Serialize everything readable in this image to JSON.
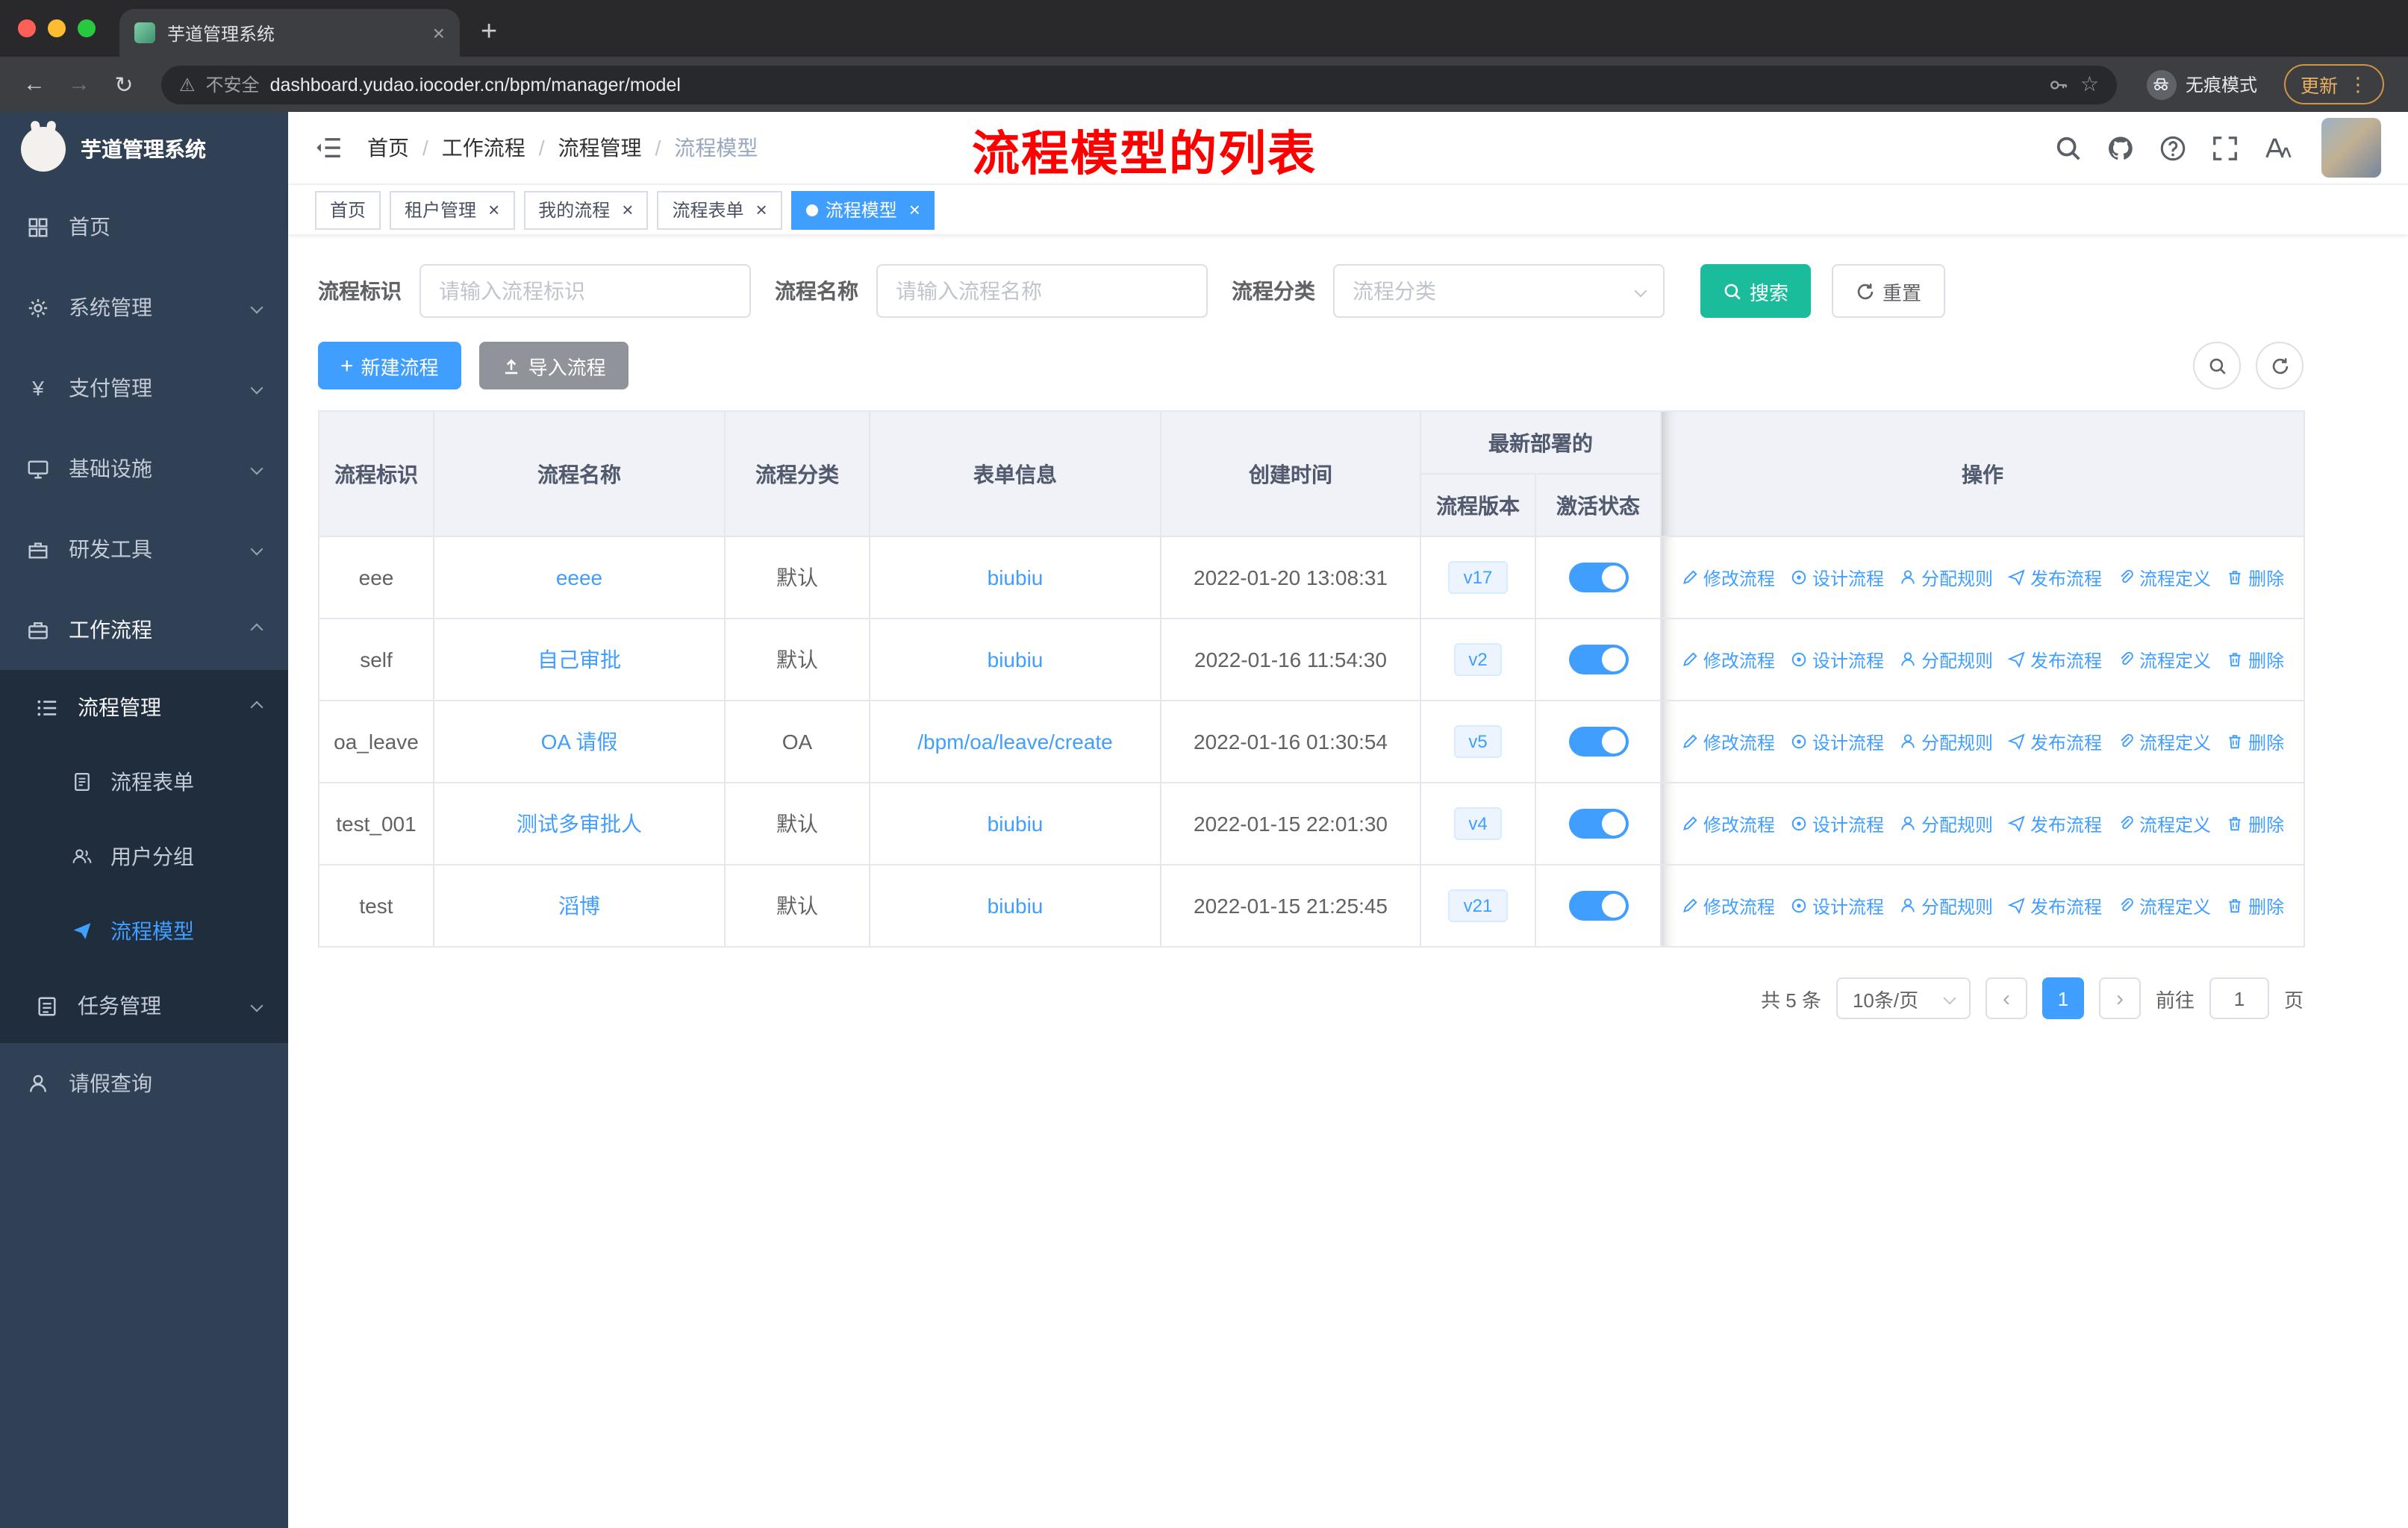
{
  "colors": {
    "primary": "#409eff",
    "search_button": "#1abc9c",
    "annotation_red": "#ff0000",
    "sidebar_bg": "#304156",
    "submenu_bg": "#1f2d3d",
    "toggle_on": "#409eff"
  },
  "browser": {
    "tab_title": "芋道管理系统",
    "security_label": "不安全",
    "url": "dashboard.yudao.iocoder.cn/bpm/manager/model",
    "incognito_label": "无痕模式",
    "update_label": "更新"
  },
  "icons": {
    "close": "×",
    "plus": "+",
    "back": "←",
    "forward": "→",
    "reload": "↻",
    "warning": "⚠",
    "star": "☆",
    "more": "⋮",
    "yen": "¥",
    "prev": "‹",
    "next": "›"
  },
  "sidebar": {
    "logo_title": "芋道管理系统",
    "home": "首页",
    "system": "系统管理",
    "payment": "支付管理",
    "infra": "基础设施",
    "devtools": "研发工具",
    "workflow": "工作流程",
    "process_mgmt": "流程管理",
    "process_form": "流程表单",
    "user_group": "用户分组",
    "process_model": "流程模型",
    "task_mgmt": "任务管理",
    "leave_query": "请假查询"
  },
  "navbar": {
    "breadcrumb": [
      "首页",
      "工作流程",
      "流程管理",
      "流程模型"
    ],
    "separator": "/",
    "annotation": "流程模型的列表"
  },
  "tags": {
    "home": "首页",
    "tenant": "租户管理",
    "my_process": "我的流程",
    "process_form": "流程表单",
    "process_model": "流程模型"
  },
  "filters": {
    "key_label": "流程标识",
    "key_placeholder": "请输入流程标识",
    "name_label": "流程名称",
    "name_placeholder": "请输入流程名称",
    "category_label": "流程分类",
    "category_placeholder": "流程分类",
    "search_label": "搜索",
    "reset_label": "重置"
  },
  "toolbar": {
    "create_label": "新建流程",
    "import_label": "导入流程"
  },
  "table": {
    "headers": {
      "key": "流程标识",
      "name": "流程名称",
      "category": "流程分类",
      "form": "表单信息",
      "created": "创建时间",
      "deploy_group": "最新部署的",
      "version": "流程版本",
      "active": "激活状态",
      "ops": "操作"
    },
    "rows": [
      {
        "key": "eee",
        "name": "eeee",
        "category": "默认",
        "form": "biubiu",
        "created": "2022-01-20 13:08:31",
        "version": "v17",
        "active": true
      },
      {
        "key": "self",
        "name": "自己审批",
        "category": "默认",
        "form": "biubiu",
        "created": "2022-01-16 11:54:30",
        "version": "v2",
        "active": true
      },
      {
        "key": "oa_leave",
        "name": "OA 请假",
        "category": "OA",
        "form": "/bpm/oa/leave/create",
        "created": "2022-01-16 01:30:54",
        "version": "v5",
        "active": true
      },
      {
        "key": "test_001",
        "name": "测试多审批人",
        "category": "默认",
        "form": "biubiu",
        "created": "2022-01-15 22:01:30",
        "version": "v4",
        "active": true
      },
      {
        "key": "test",
        "name": "滔博",
        "category": "默认",
        "form": "biubiu",
        "created": "2022-01-15 21:25:45",
        "version": "v21",
        "active": true
      }
    ],
    "actions": [
      {
        "label": "修改流程",
        "icon": "edit-icon"
      },
      {
        "label": "设计流程",
        "icon": "design-icon"
      },
      {
        "label": "分配规则",
        "icon": "assign-rule-icon"
      },
      {
        "label": "发布流程",
        "icon": "publish-icon"
      },
      {
        "label": "流程定义",
        "icon": "definition-icon"
      },
      {
        "label": "删除",
        "icon": "delete-icon"
      }
    ]
  },
  "pagination": {
    "total": "共 5 条",
    "page_size": "10条/页",
    "page": "1",
    "goto_label": "前往",
    "goto_value": "1",
    "unit_label": "页"
  }
}
